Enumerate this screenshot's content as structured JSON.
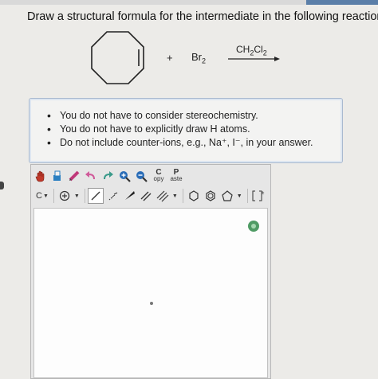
{
  "question": "Draw a structural formula for the intermediate in the following reaction:",
  "reaction": {
    "plus": "+",
    "reactant2_base": "Br",
    "reactant2_sub": "2",
    "reagent_parts": [
      "CH",
      "2",
      "Cl",
      "2"
    ]
  },
  "notes": [
    "You do not have to consider stereochemistry.",
    "You do not have to explicitly draw H atoms.",
    "Do not include counter-ions, e.g., Na⁺, I⁻, in your answer."
  ],
  "toolbar": {
    "copy": {
      "top": "C",
      "bottom": "opy"
    },
    "paste": {
      "top": "P",
      "bottom": "aste"
    },
    "carbon_label": "C"
  },
  "icons": [
    "hand-icon",
    "eraser-icon",
    "pencil-icon",
    "undo-icon",
    "redo-icon",
    "zoom-in-icon",
    "zoom-out-icon",
    "plus-charge-icon",
    "single-bond-icon",
    "wedge-icon",
    "hash-icon",
    "double-bond-icon",
    "triple-bond-icon",
    "cyclohexane-icon",
    "benzene-icon",
    "cyclopentane-icon",
    "bracket-icon",
    "help-icon"
  ]
}
